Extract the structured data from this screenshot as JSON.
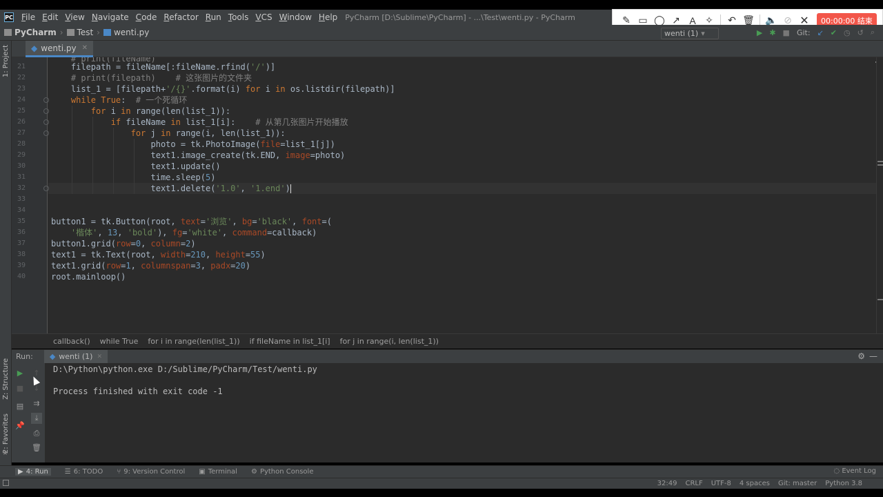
{
  "app": {
    "icon_text": "PC",
    "window_title": "PyCharm [D:\\Sublime\\PyCharm] - ...\\Test\\wenti.py - PyCharm"
  },
  "menu": {
    "items": [
      {
        "mn": "F",
        "rest": "ile"
      },
      {
        "mn": "E",
        "rest": "dit"
      },
      {
        "mn": "V",
        "rest": "iew"
      },
      {
        "mn": "N",
        "rest": "avigate"
      },
      {
        "mn": "C",
        "rest": "ode"
      },
      {
        "mn": "R",
        "rest": "efactor"
      },
      {
        "mn": "R",
        "rest": "un"
      },
      {
        "mn": "T",
        "rest": "ools"
      },
      {
        "mn": "V",
        "rest": "CS"
      },
      {
        "mn": "W",
        "rest": "indow"
      },
      {
        "mn": "H",
        "rest": "elp"
      }
    ]
  },
  "recorder": {
    "timer": "00:00:00 结束"
  },
  "nav": {
    "project": "PyCharm",
    "folder": "Test",
    "file": "wenti.py",
    "run_config": "wenti (1)",
    "git_label": "Git:"
  },
  "side": {
    "project_label": "1: Project",
    "structure_label": "Z: Structure",
    "favorites_label": "2: Favorites"
  },
  "editor": {
    "tab_label": "wenti.py",
    "lines": [
      {
        "n": "21",
        "html": "    <span>filepath = fileName[:fileName.rfind(</span><span class=\"str\">'/'</span><span>)]</span>"
      },
      {
        "n": "22",
        "html": "    <span class=\"cm\"># print(filepath)    # 这张图片的文件夹</span>"
      },
      {
        "n": "23",
        "html": "    <span>list_1 = [filepath+</span><span class=\"str\">'/{}'</span><span>.format(i) </span><span class=\"kw\">for</span><span> i </span><span class=\"kw\">in</span><span> os.listdir(filepath)]</span>"
      },
      {
        "n": "24",
        "html": "    <span class=\"kw\">while True</span><span>:  </span><span class=\"cm\"># 一个死循环</span>"
      },
      {
        "n": "25",
        "html": "        <span class=\"kw\">for</span><span> i </span><span class=\"kw\">in</span><span> range(len(list_1)):</span>"
      },
      {
        "n": "26",
        "html": "            <span class=\"kw\">if</span><span> fileName </span><span class=\"kw\">in</span><span> list_1[i]:    </span><span class=\"cm\"># 从第几张图片开始播放</span>"
      },
      {
        "n": "27",
        "html": "                <span class=\"kw\">for</span><span> j </span><span class=\"kw\">in</span><span> range(i, len(list_1)):</span>"
      },
      {
        "n": "28",
        "html": "                    <span>photo = tk.PhotoImage(</span><span class=\"kwarg\">file</span><span>=list_1[j])</span>"
      },
      {
        "n": "29",
        "html": "                    <span>text1.image_create(tk.END, </span><span class=\"kwarg\">image</span><span>=photo)</span>"
      },
      {
        "n": "30",
        "html": "                    <span>text1.update()</span>"
      },
      {
        "n": "31",
        "html": "                    <span>time.sleep(</span><span class=\"num\">5</span><span>)</span>"
      },
      {
        "n": "32",
        "html": "                    <span>text1.delete(</span><span class=\"str\">'1.0'</span><span>, </span><span class=\"str\">'1.end'</span><span>)</span>"
      },
      {
        "n": "33",
        "html": ""
      },
      {
        "n": "34",
        "html": ""
      },
      {
        "n": "35",
        "html": "<span>button1 = tk.Button(root, </span><span class=\"kwarg\">text</span><span>=</span><span class=\"str\">'浏览'</span><span>, </span><span class=\"kwarg\">bg</span><span>=</span><span class=\"str\">'black'</span><span>, </span><span class=\"kwarg\">font</span><span>=(</span>"
      },
      {
        "n": "36",
        "html": "    <span class=\"str\">'楷体'</span><span>, </span><span class=\"num\">13</span><span>, </span><span class=\"str\">'bold'</span><span>), </span><span class=\"kwarg\">fg</span><span>=</span><span class=\"str\">'white'</span><span>, </span><span class=\"kwarg\">command</span><span>=callback)</span>"
      },
      {
        "n": "37",
        "html": "<span>button1.grid(</span><span class=\"kwarg\">row</span><span>=</span><span class=\"num\">0</span><span>, </span><span class=\"kwarg\">column</span><span>=</span><span class=\"num\">2</span><span>)</span>"
      },
      {
        "n": "38",
        "html": "<span>text1 = tk.Text(root, </span><span class=\"kwarg\">width</span><span>=</span><span class=\"num\">210</span><span>, </span><span class=\"kwarg\">height</span><span>=</span><span class=\"num\">55</span><span>)</span>"
      },
      {
        "n": "39",
        "html": "<span>text1.grid(</span><span class=\"kwarg\">row</span><span>=</span><span class=\"num\">1</span><span>, </span><span class=\"kwarg\">columnspan</span><span>=</span><span class=\"num\">3</span><span>, </span><span class=\"kwarg\">padx</span><span>=</span><span class=\"num\">20</span><span>)</span>"
      },
      {
        "n": "40",
        "html": "<span>root.mainloop()</span>"
      }
    ],
    "breadcrumbs": [
      "callback()",
      "while True",
      "for i in range(len(list_1))",
      "if fileName in list_1[i]",
      "for j in range(i, len(list_1))"
    ]
  },
  "run": {
    "title": "Run:",
    "tab_label": "wenti (1)",
    "console": [
      "D:\\Python\\python.exe D:/Sublime/PyCharm/Test/wenti.py",
      "",
      "Process finished with exit code -1"
    ]
  },
  "bottom_tabs": [
    "4: Run",
    "6: TODO",
    "9: Version Control",
    "Terminal",
    "Python Console"
  ],
  "event_log": "Event Log",
  "status": [
    "32:49",
    "CRLF",
    "UTF-8",
    "4 spaces",
    "Git: master",
    "Python 3.8"
  ]
}
